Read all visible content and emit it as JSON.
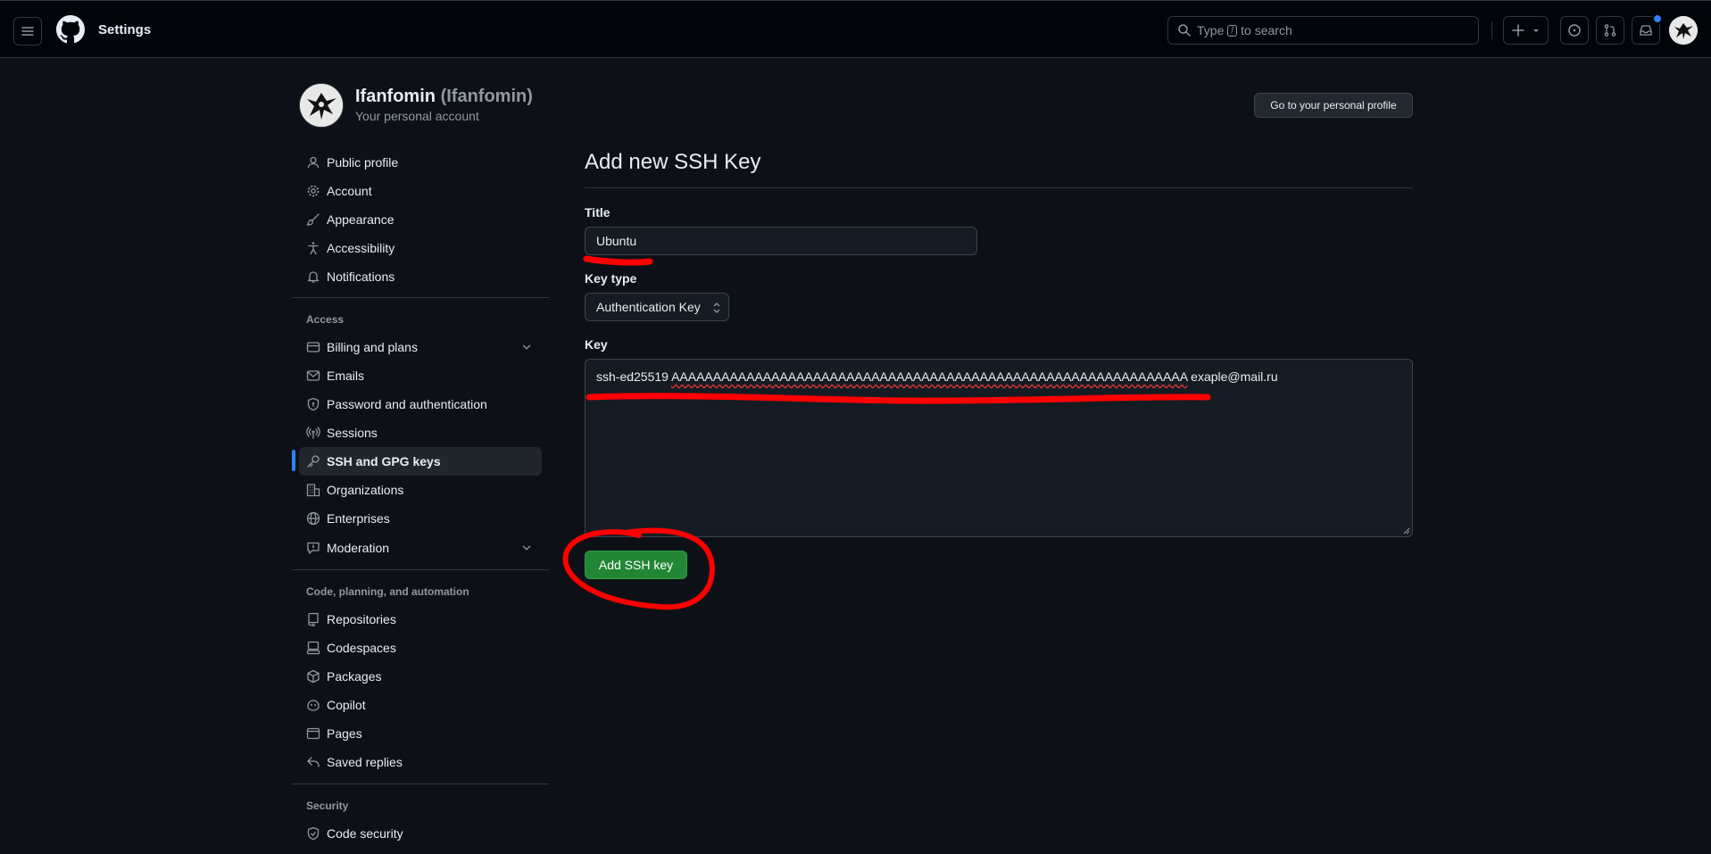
{
  "header": {
    "title": "Settings",
    "search_placeholder_prefix": "Type",
    "search_kbd": "/",
    "search_placeholder_suffix": "to search"
  },
  "user": {
    "name": "Ifanfomin",
    "login": "(Ifanfomin)",
    "subtitle": "Your personal account",
    "profile_button": "Go to your personal profile"
  },
  "sidebar": {
    "items_top": [
      {
        "label": "Public profile",
        "icon": "person-icon"
      },
      {
        "label": "Account",
        "icon": "gear-icon"
      },
      {
        "label": "Appearance",
        "icon": "paintbrush-icon"
      },
      {
        "label": "Accessibility",
        "icon": "accessibility-icon"
      },
      {
        "label": "Notifications",
        "icon": "bell-icon"
      }
    ],
    "access_heading": "Access",
    "items_access": [
      {
        "label": "Billing and plans",
        "icon": "credit-card-icon"
      },
      {
        "label": "Emails",
        "icon": "mail-icon"
      },
      {
        "label": "Password and authentication",
        "icon": "shield-lock-icon"
      },
      {
        "label": "Sessions",
        "icon": "broadcast-icon"
      },
      {
        "label": "SSH and GPG keys",
        "icon": "key-icon"
      },
      {
        "label": "Organizations",
        "icon": "organization-icon"
      },
      {
        "label": "Enterprises",
        "icon": "globe-icon"
      },
      {
        "label": "Moderation",
        "icon": "report-icon"
      }
    ],
    "code_heading": "Code, planning, and automation",
    "items_code": [
      {
        "label": "Repositories",
        "icon": "repo-icon"
      },
      {
        "label": "Codespaces",
        "icon": "codespaces-icon"
      },
      {
        "label": "Packages",
        "icon": "package-icon"
      },
      {
        "label": "Copilot",
        "icon": "copilot-icon"
      },
      {
        "label": "Pages",
        "icon": "browser-icon"
      },
      {
        "label": "Saved replies",
        "icon": "reply-icon"
      }
    ],
    "security_heading": "Security",
    "items_security": [
      {
        "label": "Code security",
        "icon": "shield-check-icon"
      }
    ]
  },
  "form": {
    "heading": "Add new SSH Key",
    "title_label": "Title",
    "title_value": "Ubuntu",
    "key_type_label": "Key type",
    "key_type_value": "Authentication Key",
    "key_label": "Key",
    "key_prefix": "ssh-ed25519",
    "key_body": "AAAAAAAAAAAAAAAAAAAAAAAAAAAAAAAAAAAAAAAAAAAAAAAAAAAAAAAAAAAAAA",
    "key_comment": "exaple@mail.ru",
    "submit_label": "Add SSH key"
  },
  "colors": {
    "accent": "#2f81f7",
    "primary_button": "#238636",
    "annotation": "#ff0000",
    "background": "#0d1117"
  }
}
